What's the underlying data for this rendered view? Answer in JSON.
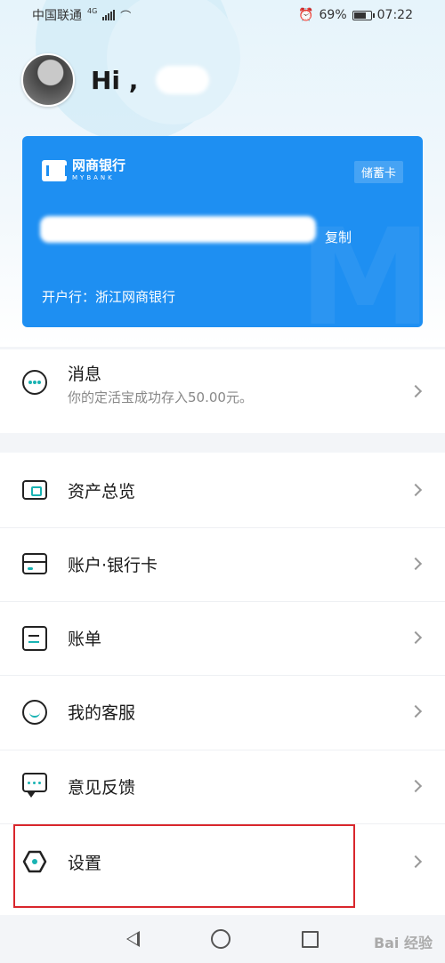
{
  "status_bar": {
    "carrier": "中国联通",
    "network": "4G",
    "alarm_icon": "alarm-icon",
    "battery_percent": "69%",
    "battery_level": 0.69,
    "time": "07:22"
  },
  "header": {
    "greeting": "Hi ,"
  },
  "card": {
    "bank_name": "网商银行",
    "bank_name_en": "MYBANK",
    "card_type": "储蓄卡",
    "copy_label": "复制",
    "branch_label": "开户行：浙江网商银行"
  },
  "messages": {
    "title": "消息",
    "subtitle": "你的定活宝成功存入50.00元。"
  },
  "menu": {
    "items": [
      {
        "label": "资产总览",
        "icon": "wallet-icon"
      },
      {
        "label": "账户·银行卡",
        "icon": "card-icon"
      },
      {
        "label": "账单",
        "icon": "bill-icon"
      },
      {
        "label": "我的客服",
        "icon": "service-icon"
      },
      {
        "label": "意见反馈",
        "icon": "feedback-icon"
      },
      {
        "label": "设置",
        "icon": "settings-icon"
      }
    ]
  },
  "nav": {
    "icons": [
      "back-icon",
      "home-icon",
      "recent-apps-icon"
    ]
  },
  "colors": {
    "card_blue": "#1e8ff2",
    "accent_teal": "#19b3b3",
    "highlight_red": "#d9262c"
  }
}
